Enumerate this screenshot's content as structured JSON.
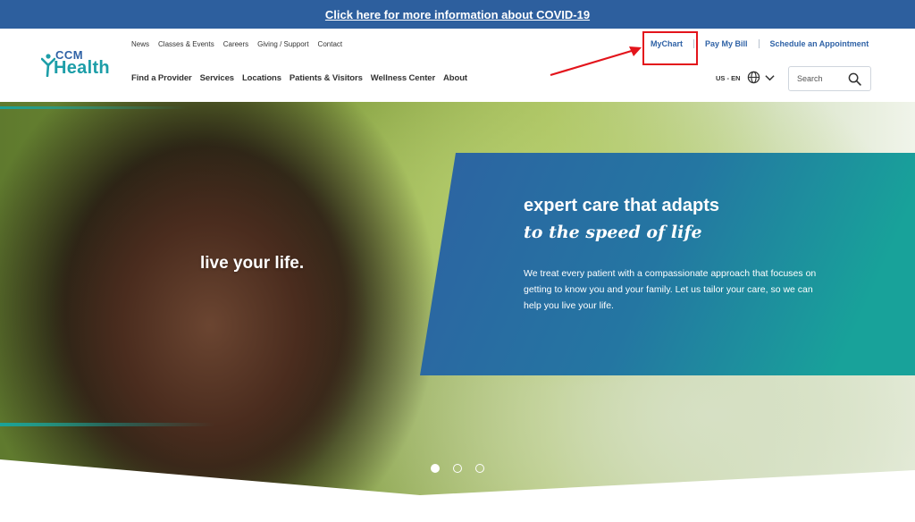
{
  "banner": {
    "text": "Click here for more information about COVID-19"
  },
  "logo": {
    "line1": "CCM",
    "line2": "Health"
  },
  "utility_nav": [
    "News",
    "Classes & Events",
    "Careers",
    "Giving / Support",
    "Contact"
  ],
  "main_nav": [
    "Find a Provider",
    "Services",
    "Locations",
    "Patients & Visitors",
    "Wellness Center",
    "About"
  ],
  "top_links": {
    "mychart": "MyChart",
    "pay_bill": "Pay My Bill",
    "schedule": "Schedule an Appointment"
  },
  "lang": "US - EN",
  "search": {
    "placeholder": "Search"
  },
  "hero": {
    "overlay_text": "live your life.",
    "heading": "expert care that adapts",
    "subheading": "to the speed of life",
    "body": "We treat every patient with a compassionate approach that focuses on getting to know you and your family. Let us tailor your care, so we can help you live your life."
  },
  "carousel": {
    "slides": 3,
    "active": 1
  },
  "colors": {
    "banner": "#2d5f9e",
    "brand_blue": "#2f62a6",
    "brand_teal": "#1d9ea8",
    "panel_start": "#2d62a2",
    "panel_end": "#18a29a",
    "annotation_red": "#e3141b"
  },
  "icons": [
    "globe-icon",
    "chevron-down-icon",
    "search-icon",
    "logo-figure-icon"
  ]
}
